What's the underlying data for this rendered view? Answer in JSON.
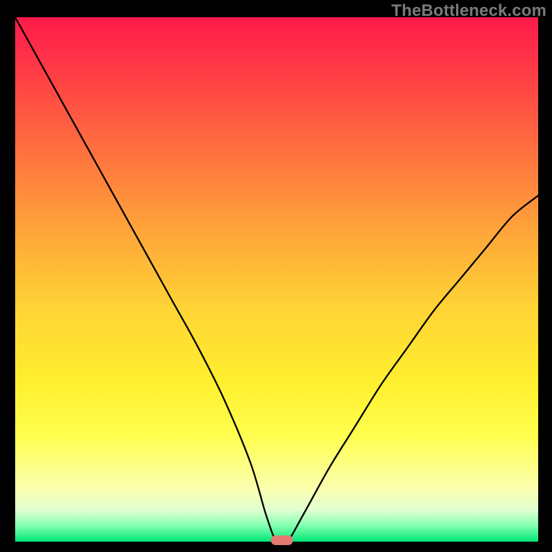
{
  "watermark": "TheBottleneck.com",
  "chart_data": {
    "type": "line",
    "title": "",
    "xlabel": "",
    "ylabel": "",
    "xlim": [
      0,
      100
    ],
    "ylim": [
      0,
      100
    ],
    "grid": false,
    "legend": false,
    "series": [
      {
        "name": "bottleneck-curve",
        "x": [
          0,
          5,
          10,
          15,
          20,
          25,
          30,
          35,
          40,
          45,
          48,
          50,
          52,
          55,
          60,
          65,
          70,
          75,
          80,
          85,
          90,
          95,
          100
        ],
        "values": [
          100,
          91,
          82,
          73,
          64,
          55,
          46,
          37,
          27,
          15,
          5,
          0,
          0,
          5,
          14,
          22,
          30,
          37,
          44,
          50,
          56,
          62,
          66
        ]
      }
    ],
    "marker": {
      "x": 51,
      "y": 0,
      "shape": "rounded-rect",
      "color": "#e37b72"
    },
    "background_gradient": {
      "top": "#ff1a4a",
      "bottom": "#00e676"
    }
  }
}
